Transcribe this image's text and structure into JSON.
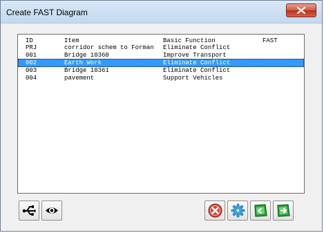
{
  "window": {
    "title": "Create FAST Diagram"
  },
  "list": {
    "headers": {
      "id": "ID",
      "item": "Item",
      "basic_function": "Basic Function",
      "fast": "FAST"
    },
    "rows": [
      {
        "id": "PRJ",
        "item": "corridor schem to Forman",
        "basic_function": "Eliminate Conflict",
        "fast": ""
      },
      {
        "id": "001",
        "item": "Bridge 10360",
        "basic_function": "Improve Transport",
        "fast": ""
      },
      {
        "id": "002",
        "item": "Earth Work",
        "basic_function": "Eliminate Conflict",
        "fast": "",
        "selected": true
      },
      {
        "id": "003",
        "item": "Bridge 10361",
        "basic_function": "Eliminate Conflict",
        "fast": ""
      },
      {
        "id": "004",
        "item": "pavement",
        "basic_function": "Support Vehicles",
        "fast": ""
      }
    ]
  },
  "toolbar": {
    "left_icons": [
      "usb-connect-icon",
      "eye-icon"
    ],
    "right_icons": [
      "cancel-icon",
      "gear-icon",
      "green-page-icon",
      "green-arrow-icon"
    ]
  },
  "colors": {
    "selection": "#3399ff",
    "close": "#c94a35",
    "accent_green": "#1d8f2a"
  }
}
